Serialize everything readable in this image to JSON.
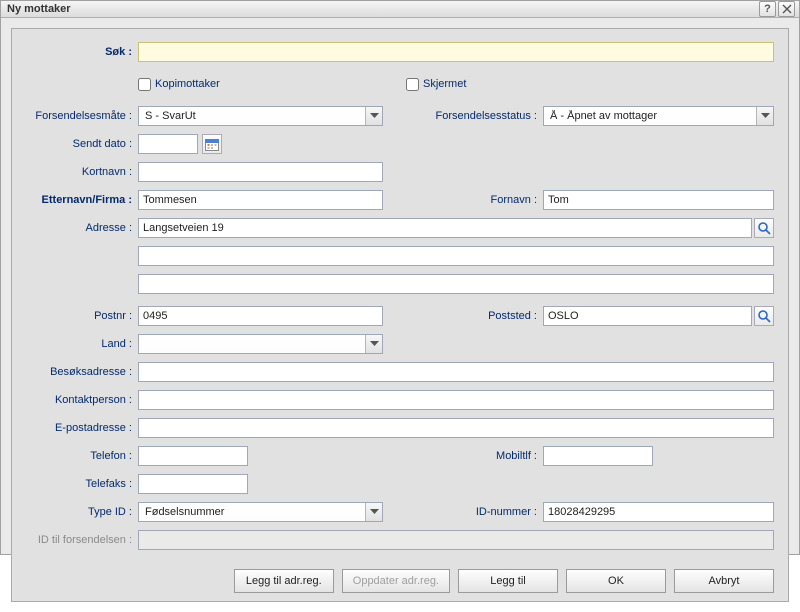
{
  "dialog": {
    "title": "Ny mottaker"
  },
  "labels": {
    "search": "Søk :",
    "kopimottaker": "Kopimottaker",
    "skjermet": "Skjermet",
    "forsendelsesmate": "Forsendelsesmåte :",
    "forsendelsesstatus": "Forsendelsesstatus :",
    "sendt_dato": "Sendt dato :",
    "kortnavn": "Kortnavn :",
    "etternavn_firma": "Etternavn/Firma :",
    "fornavn": "Fornavn :",
    "adresse": "Adresse :",
    "postnr": "Postnr :",
    "poststed": "Poststed :",
    "land": "Land :",
    "besoksadresse": "Besøksadresse :",
    "kontaktperson": "Kontaktperson :",
    "epostadresse": "E-postadresse :",
    "telefon": "Telefon :",
    "mobiltlf": "Mobiltlf :",
    "telefaks": "Telefaks :",
    "type_id": "Type ID :",
    "id_nummer": "ID-nummer :",
    "id_til_forsendelsen": "ID til forsendelsen :"
  },
  "values": {
    "forsendelsesmate": "S - SvarUt",
    "forsendelsesstatus": "Å - Åpnet av mottager",
    "sendt_dato": "",
    "kortnavn": "",
    "etternavn_firma": "Tommesen",
    "fornavn": "Tom",
    "adresse1": "Langsetveien 19",
    "adresse2": "",
    "adresse3": "",
    "postnr": "0495",
    "poststed": "OSLO",
    "land": "",
    "besoksadresse": "",
    "kontaktperson": "",
    "epostadresse": "",
    "telefon": "",
    "mobiltlf": "",
    "telefaks": "",
    "type_id": "Fødselsnummer",
    "id_nummer": "18028429295",
    "id_til_forsendelsen": ""
  },
  "buttons": {
    "legg_til_adr": "Legg til adr.reg.",
    "oppdater_adr": "Oppdater adr.reg.",
    "legg_til": "Legg til",
    "ok": "OK",
    "avbryt": "Avbryt"
  },
  "icons": {
    "help": "?",
    "close": "×"
  }
}
